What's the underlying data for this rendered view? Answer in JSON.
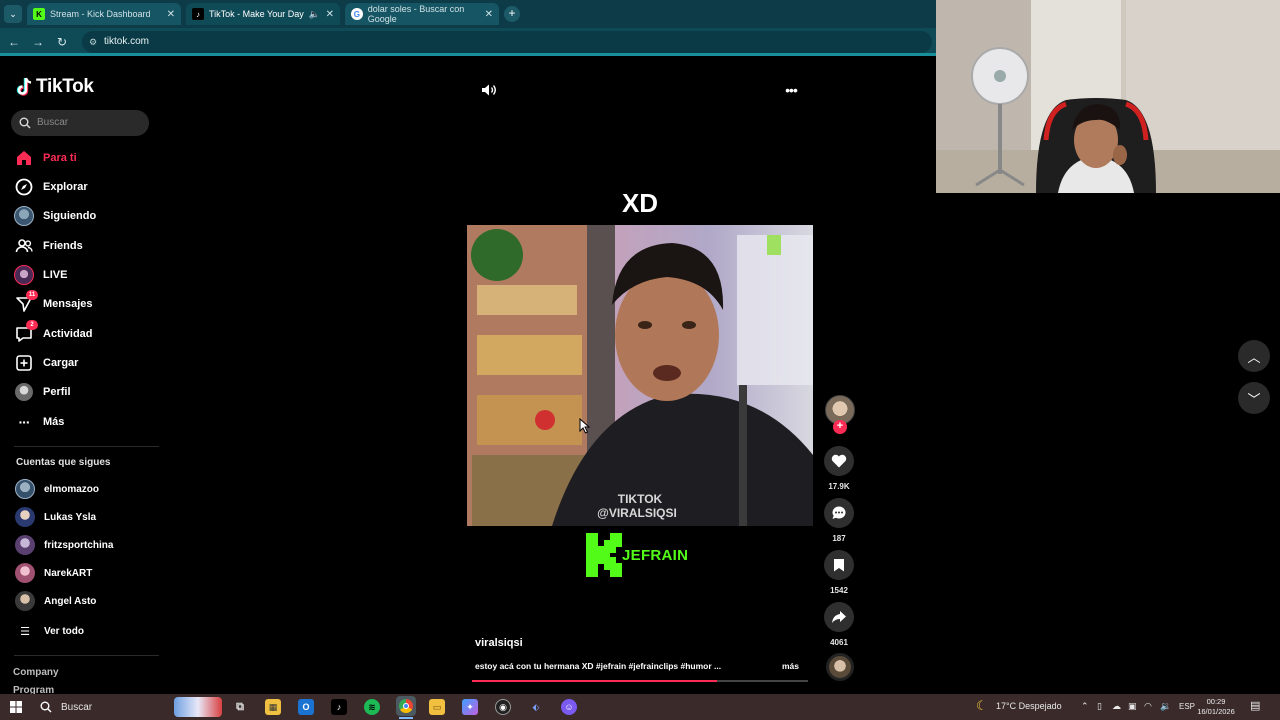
{
  "browser": {
    "tabs": [
      {
        "label": "Stream - Kick Dashboard",
        "icon": "kick-icon",
        "active": false
      },
      {
        "label": "TikTok - Make Your Day",
        "icon": "tiktok-icon",
        "active": true
      },
      {
        "label": "dolar soles - Buscar con Google",
        "icon": "google-icon",
        "active": false
      }
    ],
    "url": "tiktok.com"
  },
  "sidebar": {
    "logo": "TikTok",
    "search_placeholder": "Buscar",
    "nav": [
      {
        "label": "Para ti",
        "icon": "home-icon",
        "active": true
      },
      {
        "label": "Explorar",
        "icon": "compass-icon"
      },
      {
        "label": "Siguiendo",
        "icon": "following-avatar-icon"
      },
      {
        "label": "Friends",
        "icon": "friends-icon"
      },
      {
        "label": "LIVE",
        "icon": "live-icon"
      },
      {
        "label": "Mensajes",
        "icon": "messages-icon",
        "badge": "11"
      },
      {
        "label": "Actividad",
        "icon": "activity-icon",
        "badge": "2"
      },
      {
        "label": "Cargar",
        "icon": "upload-icon"
      },
      {
        "label": "Perfil",
        "icon": "profile-icon"
      },
      {
        "label": "Más",
        "icon": "more-icon"
      }
    ],
    "following_heading": "Cuentas que sigues",
    "following": [
      {
        "name": "elmomazoo"
      },
      {
        "name": "Lukas Ysla"
      },
      {
        "name": "fritzsportchina"
      },
      {
        "name": "NarekART"
      },
      {
        "name": "Angel Asto"
      }
    ],
    "see_all": "Ver todo",
    "footer": [
      "Company",
      "Program"
    ]
  },
  "video": {
    "title": "XD",
    "watermark_line1": "TikTok",
    "watermark_line2": "@VIRALSIQSI",
    "overlay_brand": "JEFRAIN",
    "author": "viralsiqsi",
    "caption": "estoy acá con tu hermana XD #jefrain #jefrainclips #humor ...",
    "more_label": "más",
    "progress": 0.73,
    "likes": "17.9K",
    "comments": "187",
    "saves": "1542",
    "shares": "4061"
  },
  "taskbar": {
    "search_label": "Buscar",
    "weather": "17°C  Despejado",
    "language": "ESP",
    "time": "00:29",
    "date": "16/01/2026"
  },
  "colors": {
    "tiktok_red": "#fe2c55",
    "tab_bar": "#0d3b48",
    "kick_green": "#53fc18"
  }
}
